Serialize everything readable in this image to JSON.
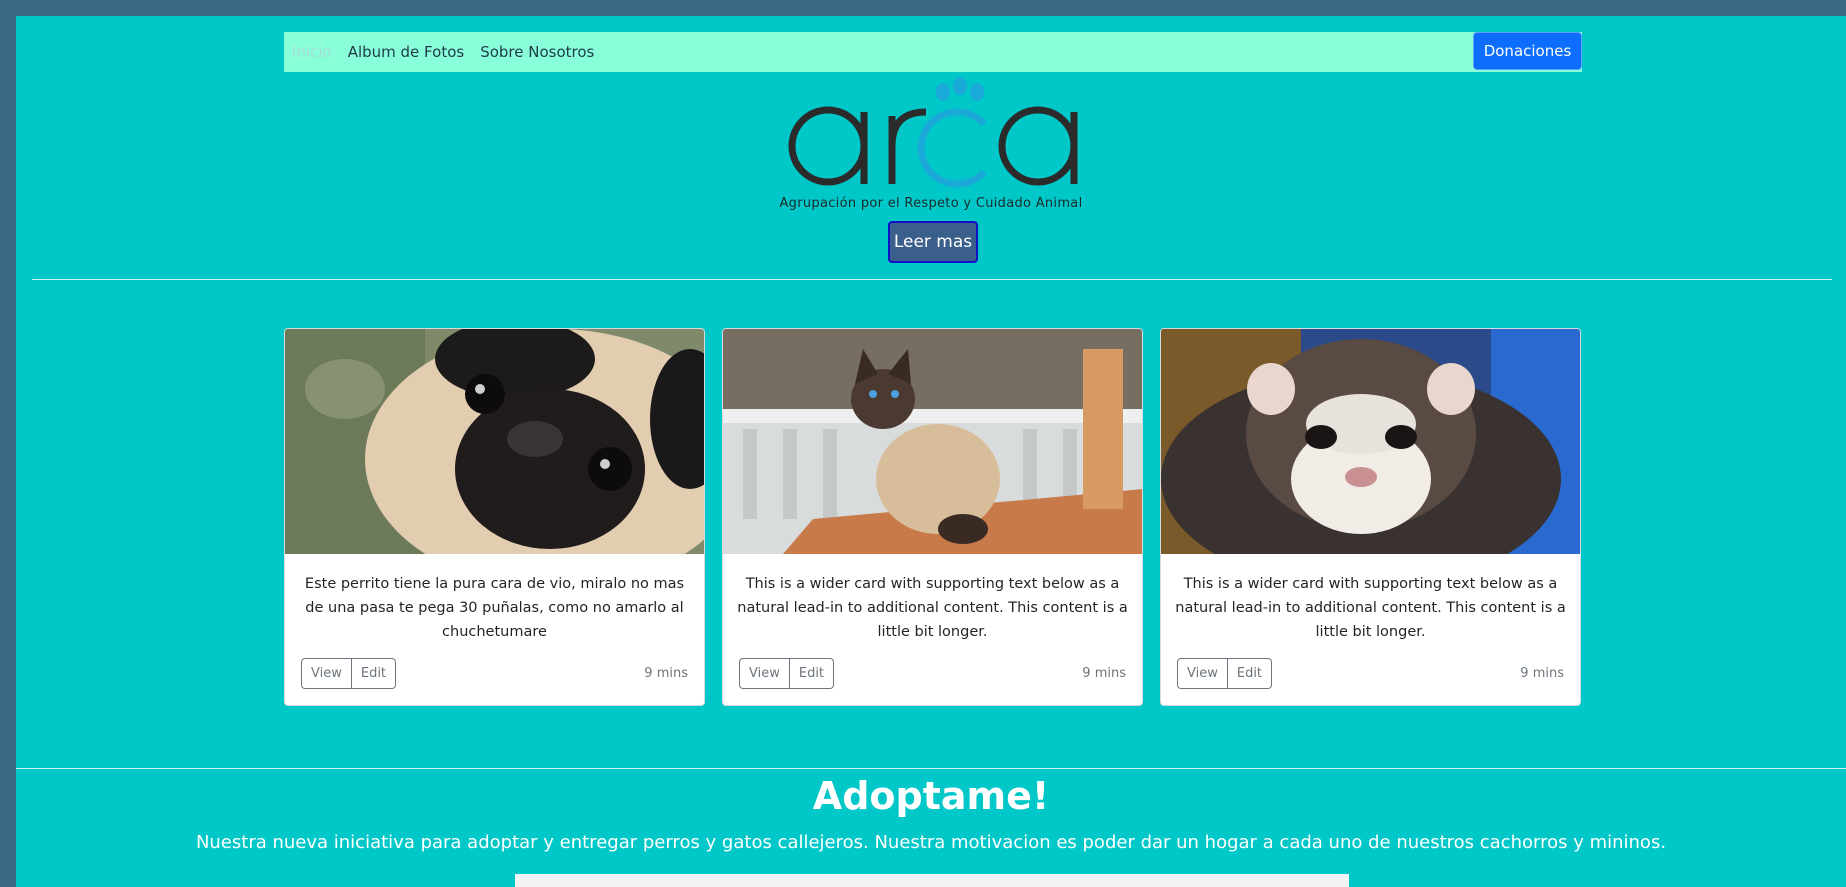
{
  "nav": {
    "items": [
      "Inicio",
      "Album de Fotos",
      "Sobre Nosotros"
    ],
    "donate_label": "Donaciones"
  },
  "hero": {
    "logo_text": "arca",
    "tagline": "Agrupación por el Respeto y Cuidado Animal",
    "button_label": "Leer mas"
  },
  "cards": [
    {
      "image": "pug-dog",
      "text": "Este perrito tiene la pura cara de vio, miralo no mas de una pasa te pega 30 puñalas, como no amarlo al chuchetumare",
      "view_label": "View",
      "edit_label": "Edit",
      "time": "9 mins"
    },
    {
      "image": "siamese-cat",
      "text": "This is a wider card with supporting text below as a natural lead-in to additional content. This content is a little bit longer.",
      "view_label": "View",
      "edit_label": "Edit",
      "time": "9 mins"
    },
    {
      "image": "ferret",
      "text": "This is a wider card with supporting text below as a natural lead-in to additional content. This content is a little bit longer.",
      "view_label": "View",
      "edit_label": "Edit",
      "time": "9 mins"
    }
  ],
  "adopt": {
    "title": "Adoptame!",
    "text": "Nuestra nueva iniciativa para adoptar y entregar perros y gatos callejeros. Nuestra motivacion es poder dar un hogar a cada uno de nuestros cachorros y mininos."
  },
  "colors": {
    "page_bg": "#00c8c8",
    "navbar_bg": "#88ffd8",
    "primary": "#0d6efd"
  }
}
